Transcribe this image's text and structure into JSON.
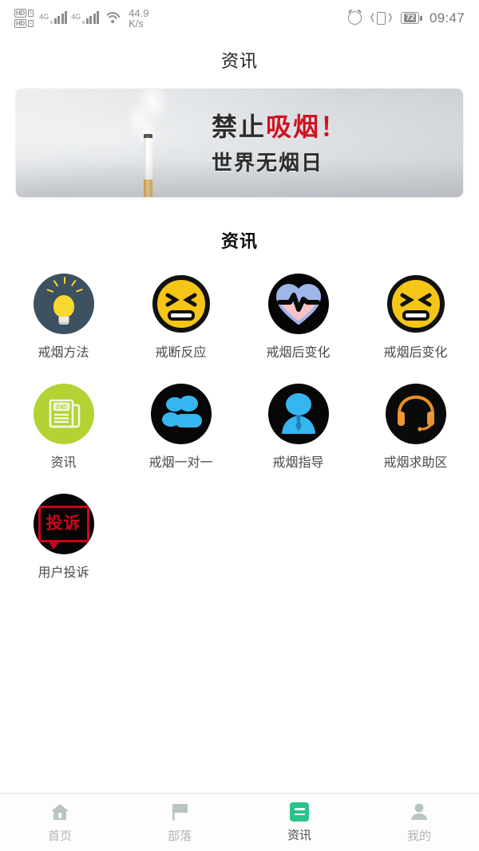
{
  "statusbar": {
    "hd1_label": "HD",
    "hd1_sim": "1",
    "hd2_label": "HD",
    "hd2_sim": "2",
    "net1": "4G",
    "net2": "4G",
    "speed_value": "44.9",
    "speed_unit": "K/s",
    "alarm_icon": "alarm-clock-icon",
    "vibrate_icon": "vibrate-icon",
    "battery_level": "72",
    "clock": "09:47"
  },
  "header": {
    "title": "资讯"
  },
  "banner": {
    "line1_black": "禁止",
    "line1_red": "吸烟！",
    "line2": "世界无烟日",
    "red_color": "#cf1322",
    "alt": "no-smoking-banner"
  },
  "section": {
    "title": "资讯"
  },
  "grid": {
    "items": [
      {
        "label": "戒烟方法",
        "icon": "lightbulb-icon",
        "bg": "#3d5161"
      },
      {
        "label": "戒断反应",
        "icon": "squint-face-icon",
        "bg": "#f5c518"
      },
      {
        "label": "戒烟后变化",
        "icon": "heart-pulse-icon",
        "bg": "#050505"
      },
      {
        "label": "戒烟后变化",
        "icon": "squint-face-icon",
        "bg": "#f5c518"
      },
      {
        "label": "资讯",
        "icon": "news-paper-icon",
        "bg": "#b3d335"
      },
      {
        "label": "戒烟一对一",
        "icon": "people-group-icon",
        "bg": "#060606"
      },
      {
        "label": "戒烟指导",
        "icon": "person-icon",
        "bg": "#060606"
      },
      {
        "label": "戒烟求助区",
        "icon": "headset-icon",
        "bg": "#0a0a0a"
      },
      {
        "label": "用户投诉",
        "icon": "complaint-icon",
        "bg": "#050505"
      }
    ],
    "news_badge_text": "NEW",
    "complaint_text": "投诉"
  },
  "tabbar": {
    "active_color": "#27c58a",
    "inactive_color": "#b9c6c0",
    "items": [
      {
        "label": "首页",
        "icon": "home-icon",
        "active": false
      },
      {
        "label": "部落",
        "icon": "flag-icon",
        "active": false
      },
      {
        "label": "资讯",
        "icon": "news-icon",
        "active": true
      },
      {
        "label": "我的",
        "icon": "person-icon",
        "active": false
      }
    ]
  }
}
